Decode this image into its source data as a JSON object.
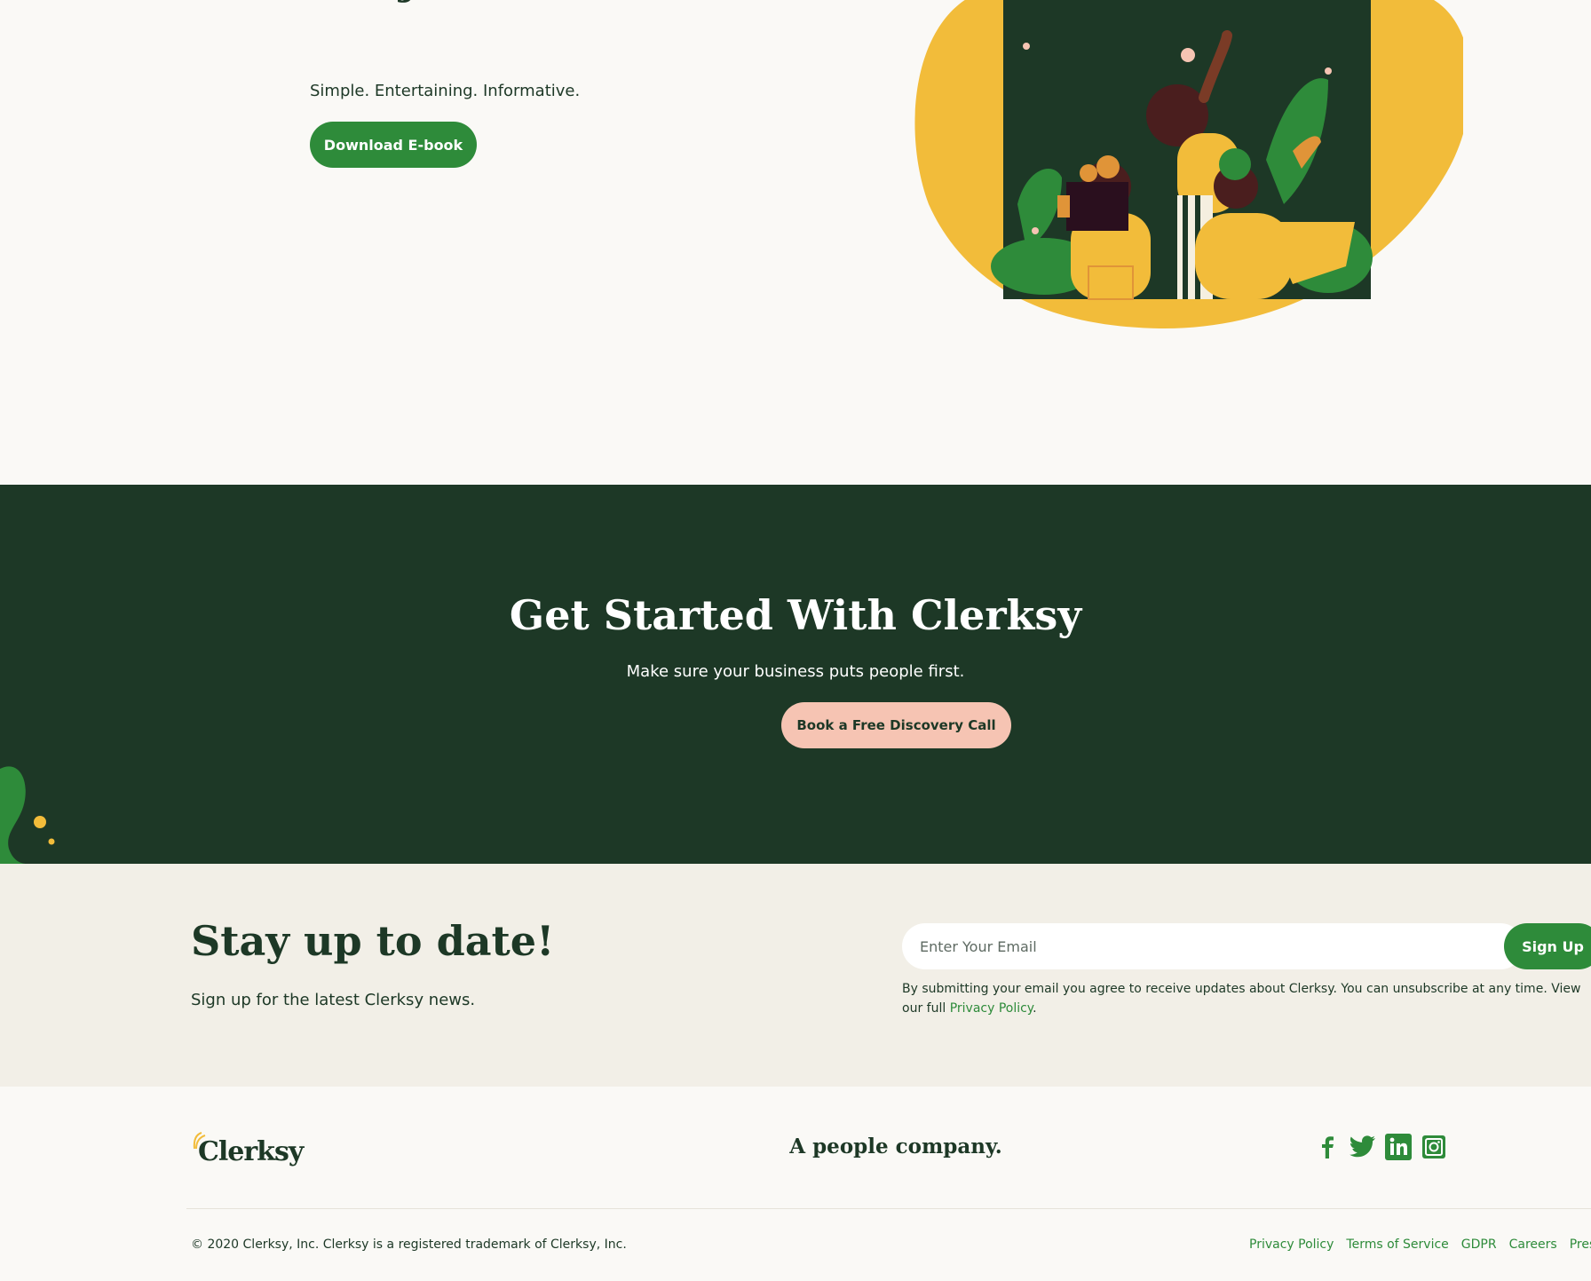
{
  "hero": {
    "title": "Not just another HR resource.",
    "subtitle": "Simple. Entertaining. Informative.",
    "download_button": "Download E-book"
  },
  "cta": {
    "title": "Get Started With Clerksy",
    "subtitle": "Make sure your business puts people first.",
    "button": "Book a Free Discovery Call"
  },
  "newsletter": {
    "title": "Stay up to date!",
    "subtitle": "Sign up for the latest Clerksy news.",
    "email_placeholder": "Enter Your Email",
    "signup_button": "Sign Up",
    "disclaimer": "By submitting your email you agree to receive updates about Clerksy. You can unsubscribe at any time. View our full",
    "privacy_link": "Privacy Policy",
    "period": "."
  },
  "footer": {
    "logo_text": "Clerksy",
    "tagline": "A people company.",
    "social_icons": [
      "facebook-icon",
      "twitter-icon",
      "linkedin-icon",
      "instagram-icon"
    ],
    "copyright": "© 2020 Clerksy, Inc. Clerksy is a registered trademark of Clerksy, Inc.",
    "links": [
      "Privacy Policy",
      "Terms of Service",
      "GDPR",
      "Careers",
      "Press Kit"
    ]
  },
  "colors": {
    "dark_green": "#1D3826",
    "brand_green": "#2E8B3A",
    "mustard": "#F2BC3A",
    "pink": "#F6C4B3",
    "cream": "#FAF9F6",
    "beige": "#F2EFE7"
  }
}
